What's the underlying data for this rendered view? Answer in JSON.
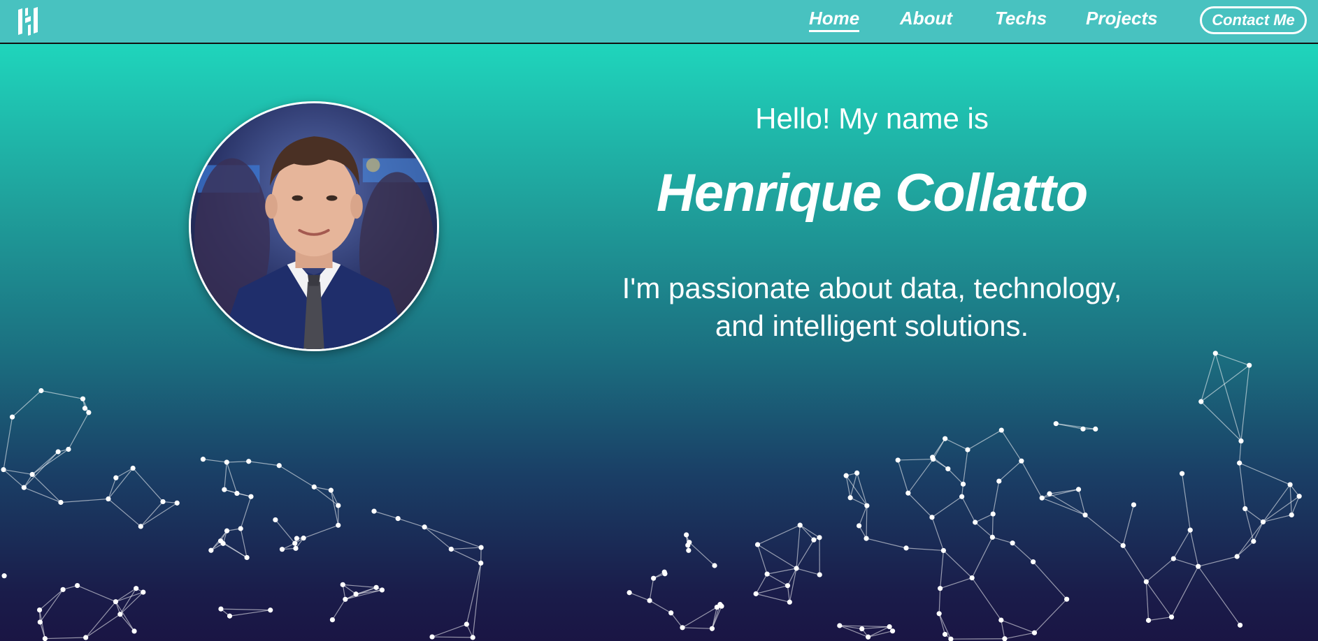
{
  "navbar": {
    "logo_icon": "hc-logo-icon",
    "links": [
      {
        "label": "Home",
        "active": true
      },
      {
        "label": "About",
        "active": false
      },
      {
        "label": "Techs",
        "active": false
      },
      {
        "label": "Projects",
        "active": false
      }
    ],
    "contact_label": "Contact Me"
  },
  "hero": {
    "greeting": "Hello! My name is",
    "name": "Henrique Collatto",
    "tagline_line1": "I'm passionate about data, technology,",
    "tagline_line2": "and intelligent solutions.",
    "avatar_icon": "profile-photo"
  },
  "colors": {
    "navbar_bg": "#48c2c0",
    "gradient_top": "#1fd5bc",
    "gradient_bottom": "#1a1544",
    "text": "#ffffff"
  }
}
